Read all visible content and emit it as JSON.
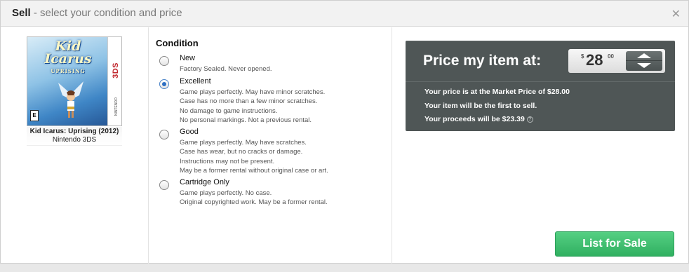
{
  "header": {
    "title_strong": "Sell",
    "title_rest": " - select your condition and price",
    "close_icon": "close-icon"
  },
  "product": {
    "cover_logo": "Kid Icarus",
    "cover_subtitle": "UPRISING",
    "cover_platform": "3DS",
    "cover_brand": "NINTENDO",
    "cover_rating": "E",
    "title": "Kid Icarus: Uprising (2012)",
    "platform": "Nintendo 3DS"
  },
  "condition": {
    "heading": "Condition",
    "selected": "Excellent",
    "options": [
      {
        "name": "New",
        "lines": [
          "Factory Sealed. Never opened."
        ]
      },
      {
        "name": "Excellent",
        "lines": [
          "Game plays perfectly. May have minor scratches.",
          "Case has no more than a few minor scratches.",
          "No damage to game instructions.",
          "No personal markings. Not a previous rental."
        ]
      },
      {
        "name": "Good",
        "lines": [
          "Game plays perfectly. May have scratches.",
          "Case has wear, but no cracks or damage.",
          "Instructions may not be present.",
          "May be a former rental without original case or art."
        ]
      },
      {
        "name": "Cartridge Only",
        "lines": [
          "Game plays perfectly. No case.",
          "Original copyrighted work. May be a former rental."
        ]
      }
    ]
  },
  "price": {
    "label": "Price my item at:",
    "currency": "$",
    "dollars": "28",
    "cents": "00",
    "market_line": "Your price is at the Market Price of $28.00",
    "first_line": "Your item will be the first to sell.",
    "proceeds_line": "Your proceeds will be $23.39",
    "help_icon": "?"
  },
  "actions": {
    "list_label": "List for Sale"
  },
  "colors": {
    "panel": "#4f5656",
    "accent_green": "#30b060",
    "radio_selected": "#2d6fc3"
  }
}
